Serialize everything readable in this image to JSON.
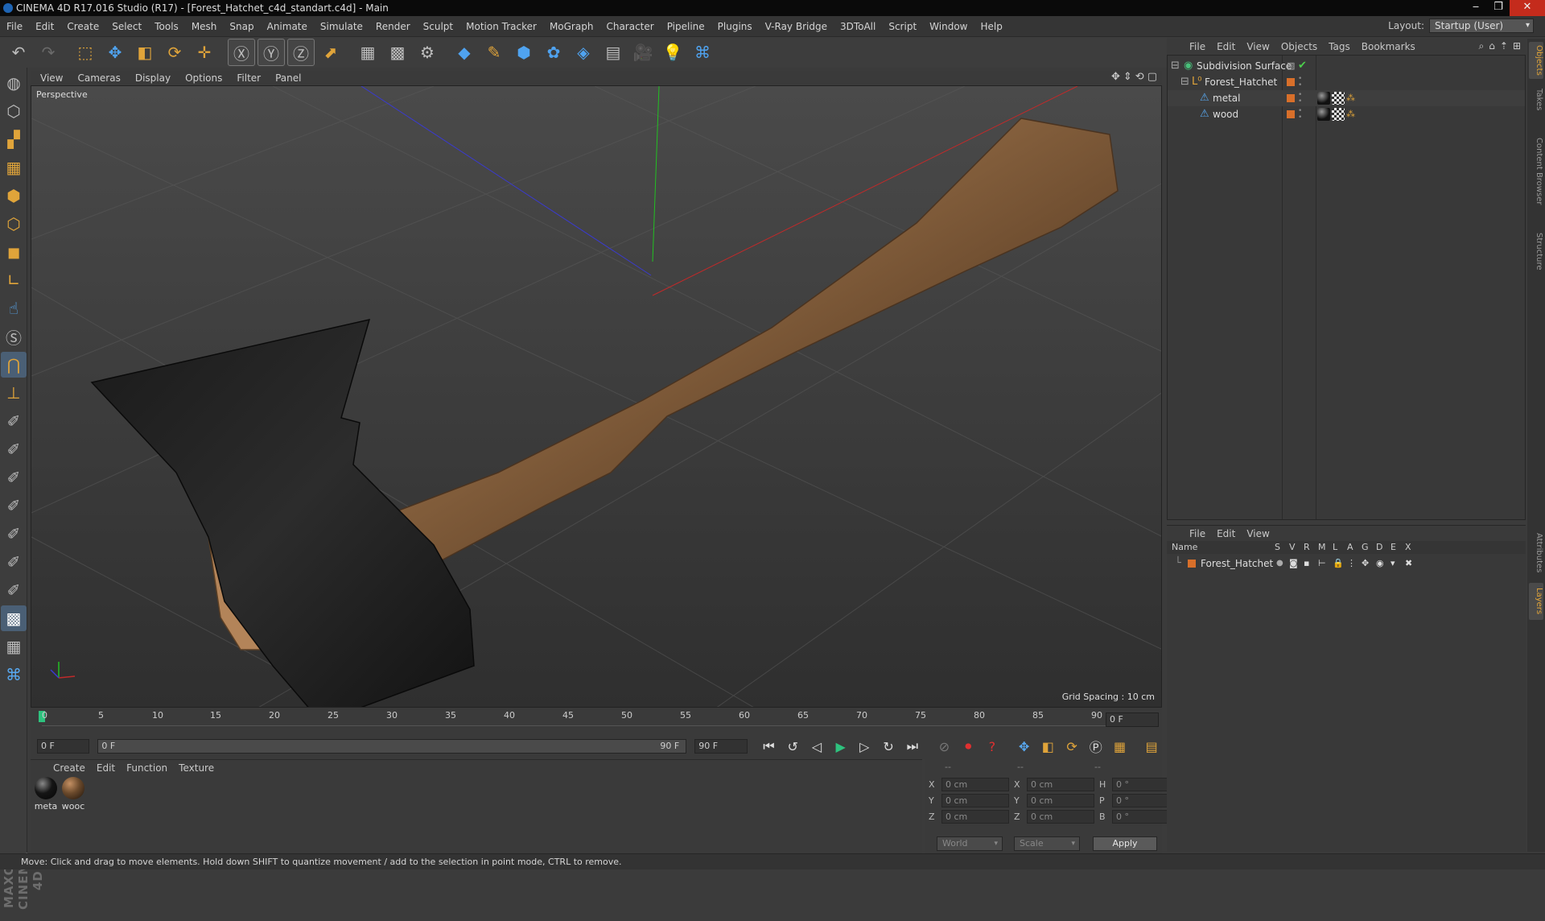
{
  "window": {
    "title": "CINEMA 4D R17.016 Studio (R17) - [Forest_Hatchet_c4d_standart.c4d] - Main",
    "controls": [
      "‒",
      "❐",
      "✕"
    ]
  },
  "menubar": {
    "items": [
      "File",
      "Edit",
      "Create",
      "Select",
      "Tools",
      "Mesh",
      "Snap",
      "Animate",
      "Simulate",
      "Render",
      "Sculpt",
      "Motion Tracker",
      "MoGraph",
      "Character",
      "Pipeline",
      "Plugins",
      "V-Ray Bridge",
      "3DToAll",
      "Script",
      "Window",
      "Help"
    ],
    "layout_label": "Layout:",
    "layout_value": "Startup (User)"
  },
  "viewport": {
    "menu": [
      "View",
      "Cameras",
      "Display",
      "Options",
      "Filter",
      "Panel"
    ],
    "label": "Perspective",
    "grid_spacing": "Grid Spacing : 10 cm"
  },
  "timeline": {
    "ticks": [
      "0",
      "5",
      "10",
      "15",
      "20",
      "25",
      "30",
      "35",
      "40",
      "45",
      "50",
      "55",
      "60",
      "65",
      "70",
      "75",
      "80",
      "85",
      "90"
    ],
    "current_frame": "0 F"
  },
  "transport": {
    "start_field": "0 F",
    "range_start": "0 F",
    "range_end": "90 F",
    "end_field": "90 F"
  },
  "materials": {
    "menu": [
      "Create",
      "Edit",
      "Function",
      "Texture"
    ],
    "items": [
      {
        "label": "meta",
        "color": "#151515"
      },
      {
        "label": "wooc",
        "color": "#6b4a2c"
      }
    ]
  },
  "coordinates": {
    "headers": [
      "--",
      "--",
      "--"
    ],
    "rows": [
      {
        "pos_label": "X",
        "pos": "0 cm",
        "size_label": "X",
        "size": "0 cm",
        "rot_label": "H",
        "rot": "0 °"
      },
      {
        "pos_label": "Y",
        "pos": "0 cm",
        "size_label": "Y",
        "size": "0 cm",
        "rot_label": "P",
        "rot": "0 °"
      },
      {
        "pos_label": "Z",
        "pos": "0 cm",
        "size_label": "Z",
        "size": "0 cm",
        "rot_label": "B",
        "rot": "0 °"
      }
    ],
    "mode": "World",
    "scale_mode": "Scale",
    "apply": "Apply"
  },
  "objects_panel": {
    "menu": [
      "File",
      "Edit",
      "View",
      "Objects",
      "Tags",
      "Bookmarks"
    ],
    "tree": [
      {
        "name": "Subdivision Surface",
        "icon": "subdivision-icon"
      },
      {
        "name": "Forest_Hatchet",
        "icon": "null-icon"
      },
      {
        "name": "metal",
        "icon": "polygon-icon"
      },
      {
        "name": "wood",
        "icon": "polygon-icon"
      }
    ]
  },
  "layers_panel": {
    "menu": [
      "File",
      "Edit",
      "View"
    ],
    "columns": [
      "Name",
      "S",
      "V",
      "R",
      "M",
      "L",
      "A",
      "G",
      "D",
      "E",
      "X"
    ],
    "rows": [
      {
        "name": "Forest_Hatchet",
        "color": "#d86f2a"
      }
    ]
  },
  "side_tabs": [
    "Objects",
    "Takes",
    "Content Browser",
    "Structure",
    "Attributes",
    "Layers"
  ],
  "status": "Move: Click and drag to move elements. Hold down SHIFT to quantize movement / add to the selection in point mode, CTRL to remove.",
  "brand": "MAXON CINEMA 4D",
  "colors": {
    "accent_orange": "#e0a43a",
    "accent_blue": "#4fa3f0",
    "layer_orange": "#d86f2a"
  }
}
